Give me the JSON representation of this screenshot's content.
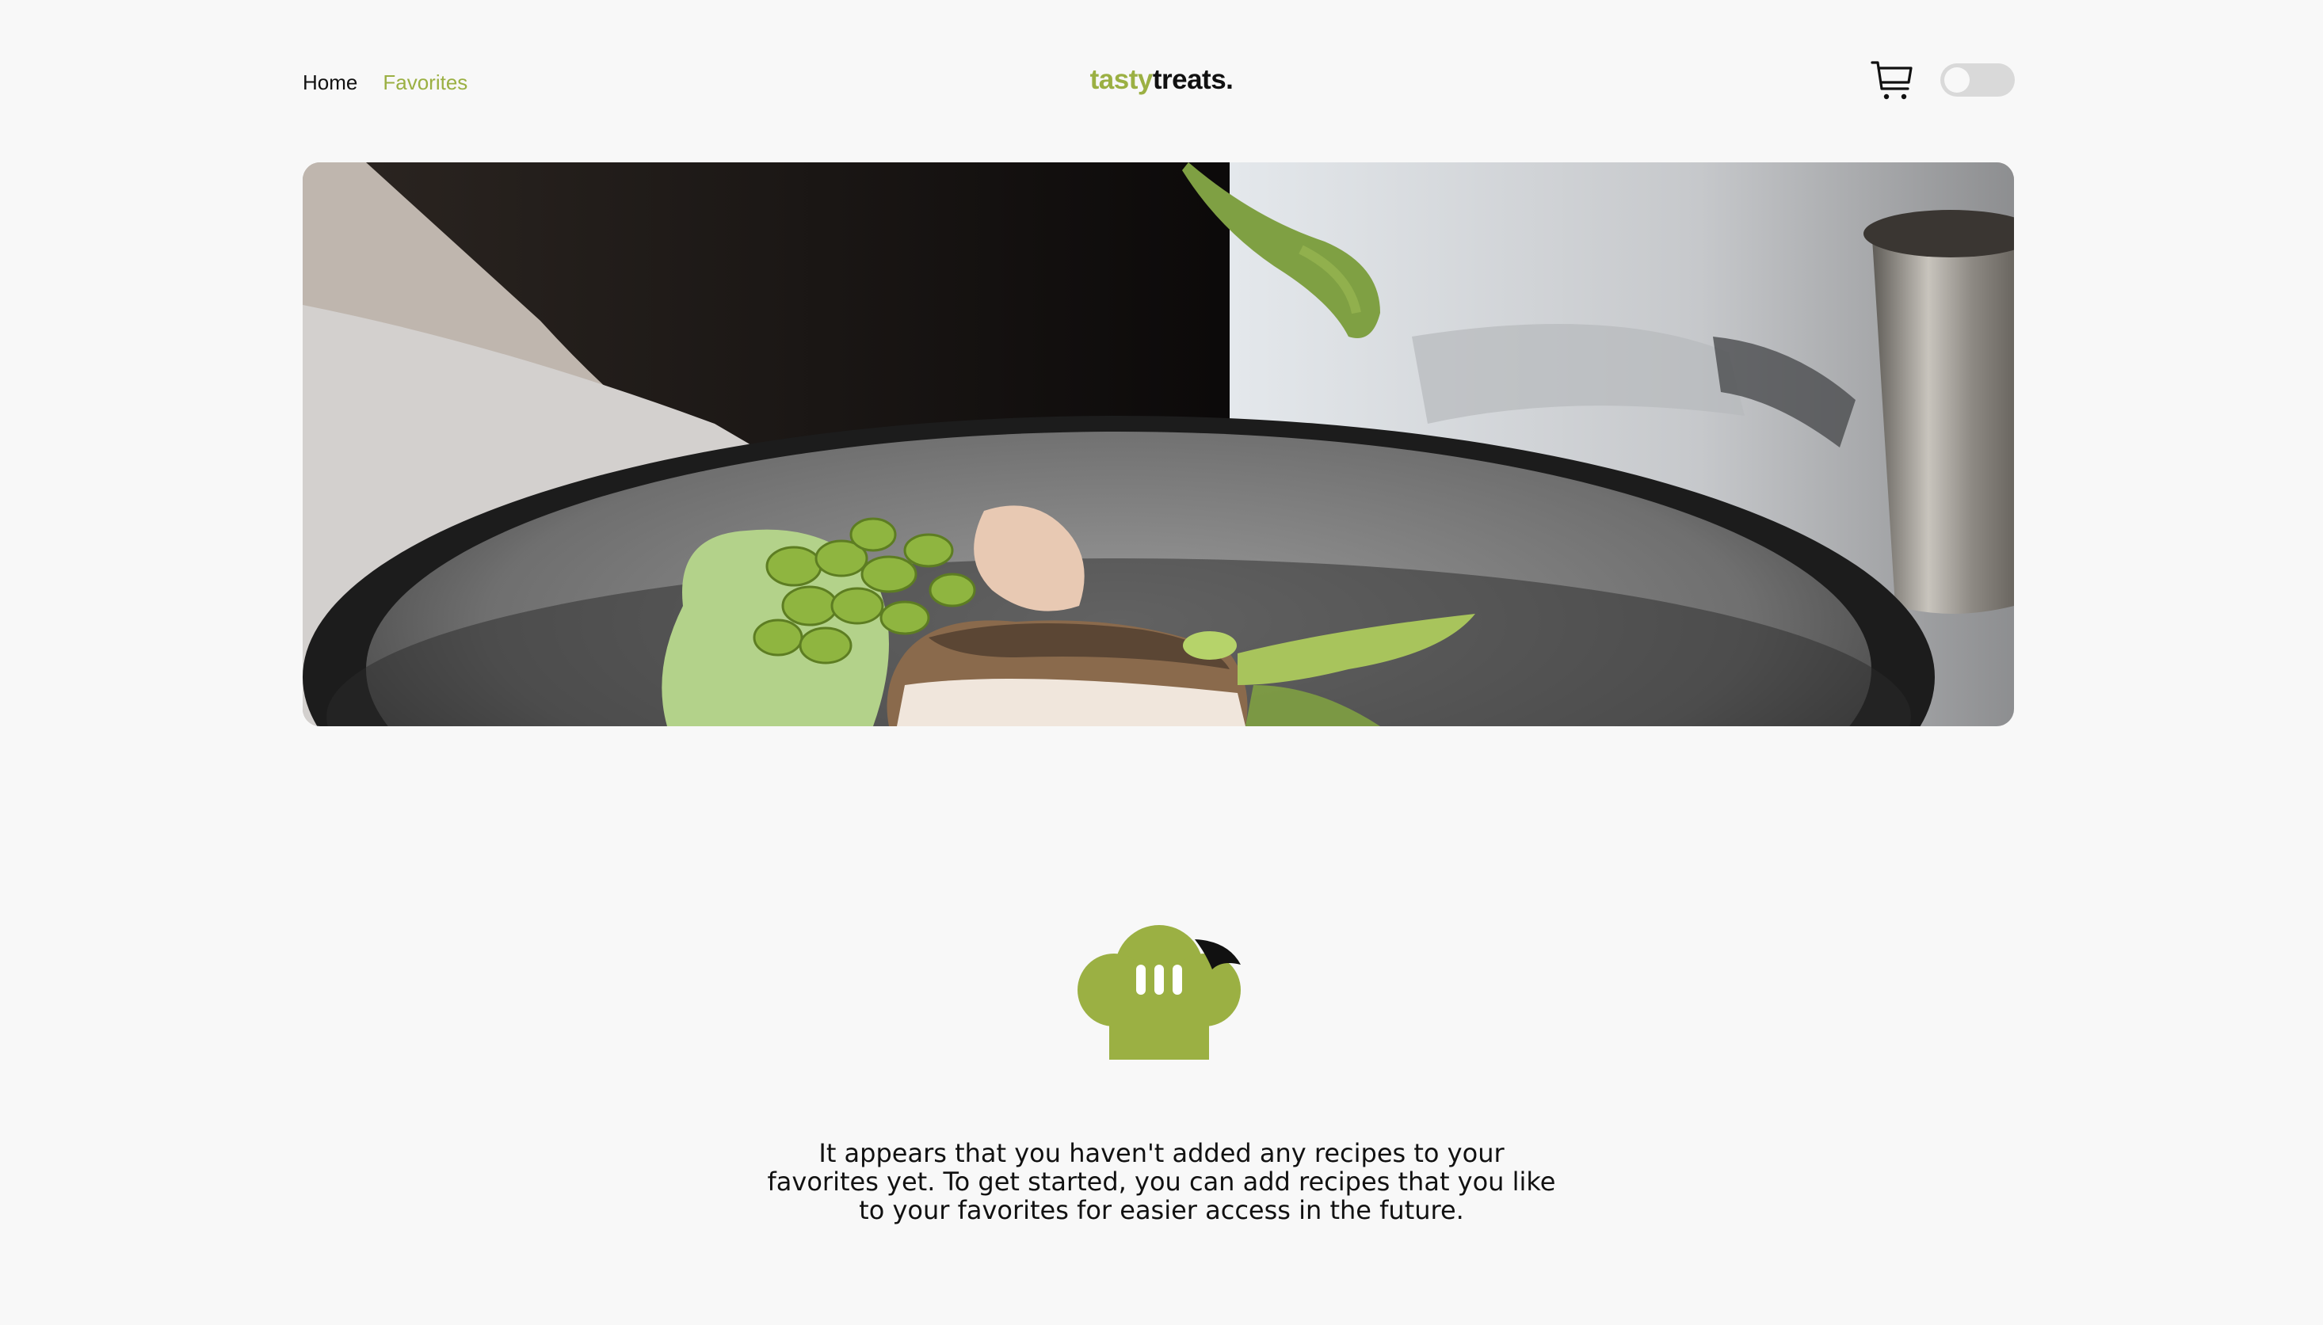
{
  "nav": {
    "home_label": "Home",
    "favorites_label": "Favorites",
    "active": "favorites"
  },
  "brand": {
    "part1": "tasty",
    "part2": "treats.",
    "accent_color": "#9bb043"
  },
  "header": {
    "cart_icon": "cart-icon",
    "theme_toggle_on": false
  },
  "hero": {
    "image": "plated fish dish with green sauce being poured"
  },
  "empty_state": {
    "icon": "chef-hat-icon",
    "message": "It appears that you haven't added any recipes to your favorites yet. To get started, you can add recipes that you like to your favorites for easier access in the future."
  }
}
